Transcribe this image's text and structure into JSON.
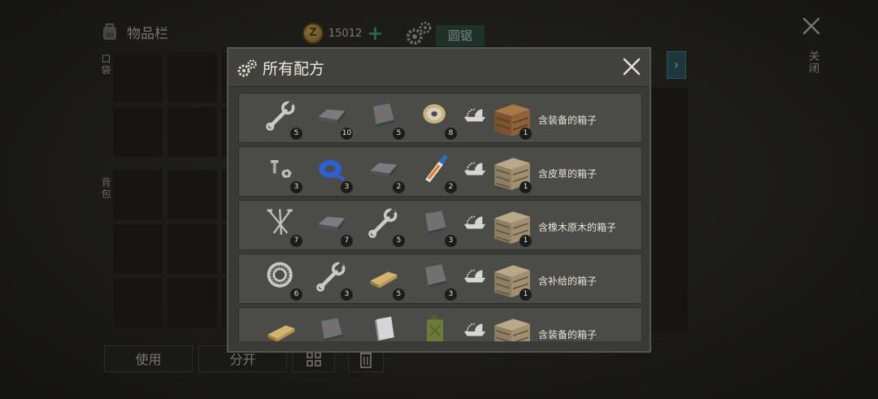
{
  "inventory": {
    "title": "物品栏",
    "pocket_label": "口袋",
    "backpack_label": "背包"
  },
  "currency": {
    "amount": "15012",
    "coin_icon": "coin-icon",
    "add_icon": "plus-icon"
  },
  "crafting": {
    "tab_label": "圆锯"
  },
  "close": {
    "label": "关闭"
  },
  "buttons": {
    "use": "使用",
    "split": "分开"
  },
  "modal": {
    "title": "所有配方",
    "recipes": [
      {
        "ingredients": [
          {
            "icon": "wrench-icon",
            "qty": "5"
          },
          {
            "icon": "steel-ingot-icon",
            "qty": "10"
          },
          {
            "icon": "metal-plate-icon",
            "qty": "5"
          },
          {
            "icon": "wire-spool-icon",
            "qty": "8"
          }
        ],
        "tool_icon": "circular-saw-icon",
        "result": {
          "icon": "wooden-crate-icon",
          "qty": "1",
          "name": "含装备的箱子"
        }
      },
      {
        "ingredients": [
          {
            "icon": "bolt-nut-icon",
            "qty": "3"
          },
          {
            "icon": "blue-tape-icon",
            "qty": "3"
          },
          {
            "icon": "steel-ingot-icon",
            "qty": "2"
          },
          {
            "icon": "glue-tube-icon",
            "qty": "2"
          }
        ],
        "tool_icon": "circular-saw-icon",
        "result": {
          "icon": "plank-crate-icon",
          "qty": "1",
          "name": "含皮草的箱子"
        }
      },
      {
        "ingredients": [
          {
            "icon": "nails-icon",
            "qty": "7"
          },
          {
            "icon": "steel-ingot-icon",
            "qty": "7"
          },
          {
            "icon": "wrench-icon",
            "qty": "5"
          },
          {
            "icon": "metal-plate-icon",
            "qty": "3"
          }
        ],
        "tool_icon": "circular-saw-icon",
        "result": {
          "icon": "plank-crate-icon",
          "qty": "1",
          "name": "含橡木原木的箱子"
        }
      },
      {
        "ingredients": [
          {
            "icon": "bearing-icon",
            "qty": "6"
          },
          {
            "icon": "wrench-icon",
            "qty": "3"
          },
          {
            "icon": "wood-plank-icon",
            "qty": "5"
          },
          {
            "icon": "metal-plate-icon",
            "qty": "3"
          }
        ],
        "tool_icon": "circular-saw-icon",
        "result": {
          "icon": "plank-crate-icon",
          "qty": "1",
          "name": "含补给的箱子"
        }
      },
      {
        "ingredients": [
          {
            "icon": "wood-plank-icon",
            "qty": ""
          },
          {
            "icon": "metal-plate-icon",
            "qty": ""
          },
          {
            "icon": "aluminum-sheet-icon",
            "qty": ""
          },
          {
            "icon": "jerrycan-icon",
            "qty": ""
          }
        ],
        "tool_icon": "circular-saw-icon",
        "result": {
          "icon": "plank-crate-icon",
          "qty": "",
          "name": "含装备的箱子"
        }
      }
    ]
  },
  "colors": {
    "accent_teal": "#2f5048",
    "arrow_blue": "#2e5b66",
    "coin_gold": "#d9b255",
    "plus_green": "#3fb37f"
  }
}
